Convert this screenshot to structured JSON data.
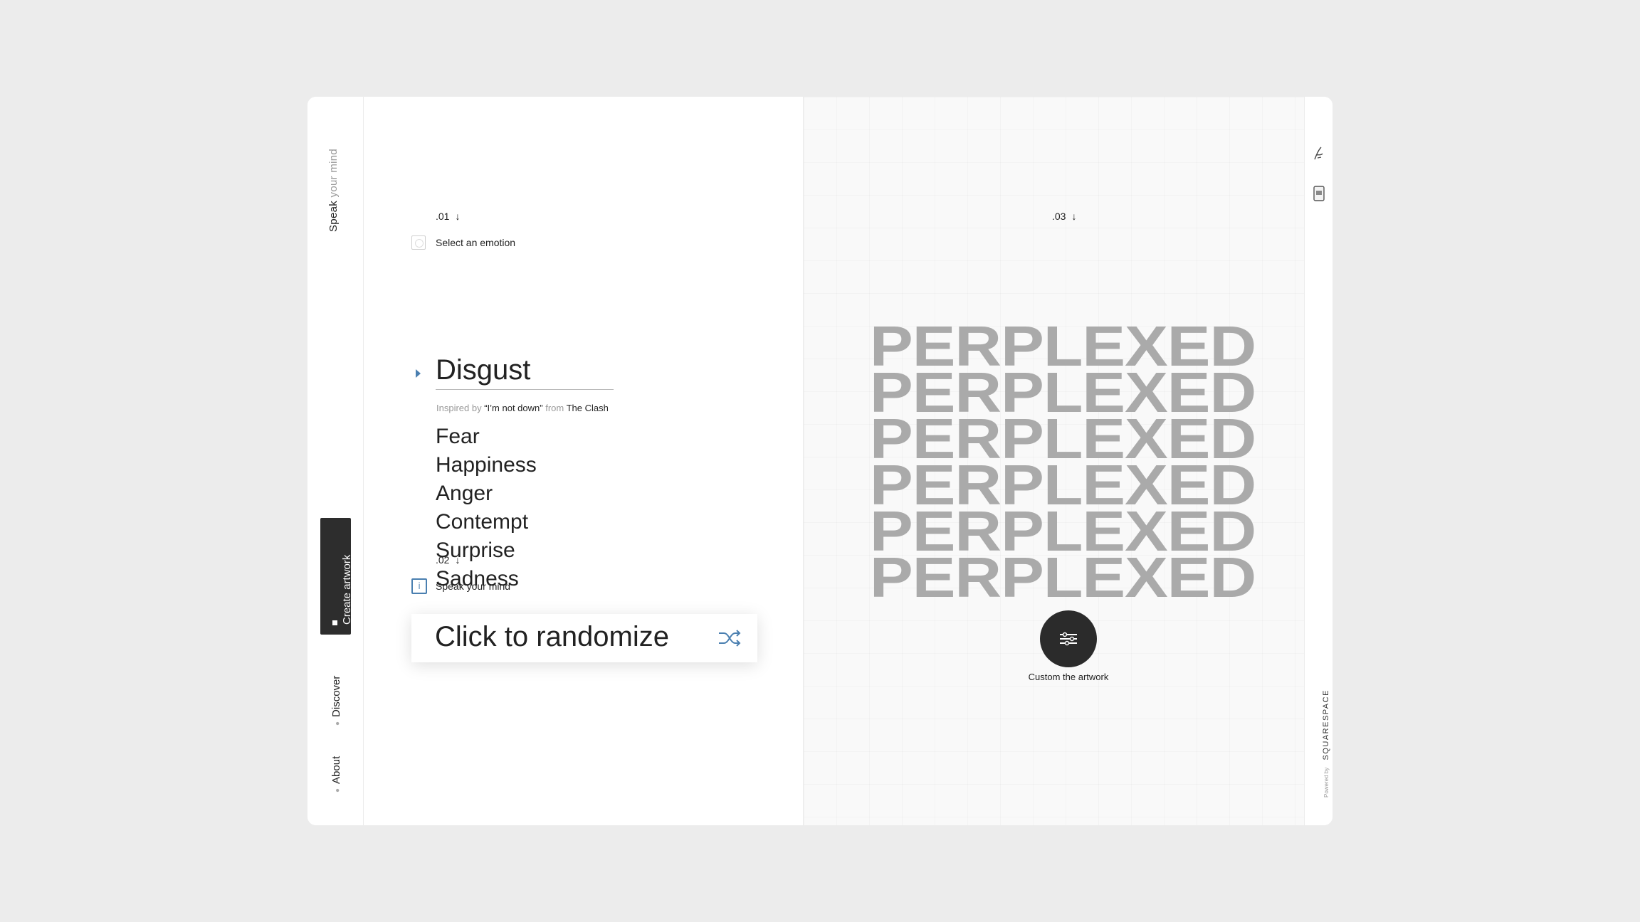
{
  "rail": {
    "title_bold": "Speak",
    "title_light": "your mind",
    "create_label": "Create artwork",
    "discover_label": "Discover",
    "about_label": "About"
  },
  "step1": {
    "number": ".01",
    "label": "Select an emotion",
    "selected": "Disgust",
    "inspired_prefix": "Inspired by",
    "song": "“I’m not down”",
    "from": "from",
    "artist": "The Clash",
    "options": [
      "Fear",
      "Happiness",
      "Anger",
      "Contempt",
      "Surprise",
      "Sadness"
    ]
  },
  "step2": {
    "number": ".02",
    "label": "Speak your mind",
    "randomize_label": "Click to randomize"
  },
  "step3": {
    "number": ".03",
    "art_word": "PERPLEXED",
    "custom_label": "Custom the artwork"
  },
  "footer": {
    "powered_by": "Powered by",
    "brand": "SQUARESPACE"
  },
  "colors": {
    "accent": "#4a7fb0",
    "dark": "#2b2b2b",
    "art_text": "#aaaaaa"
  },
  "icons": {
    "arrow_down": "↓",
    "info": "i",
    "shuffle": "shuffle-icon",
    "sliders": "sliders-icon"
  }
}
